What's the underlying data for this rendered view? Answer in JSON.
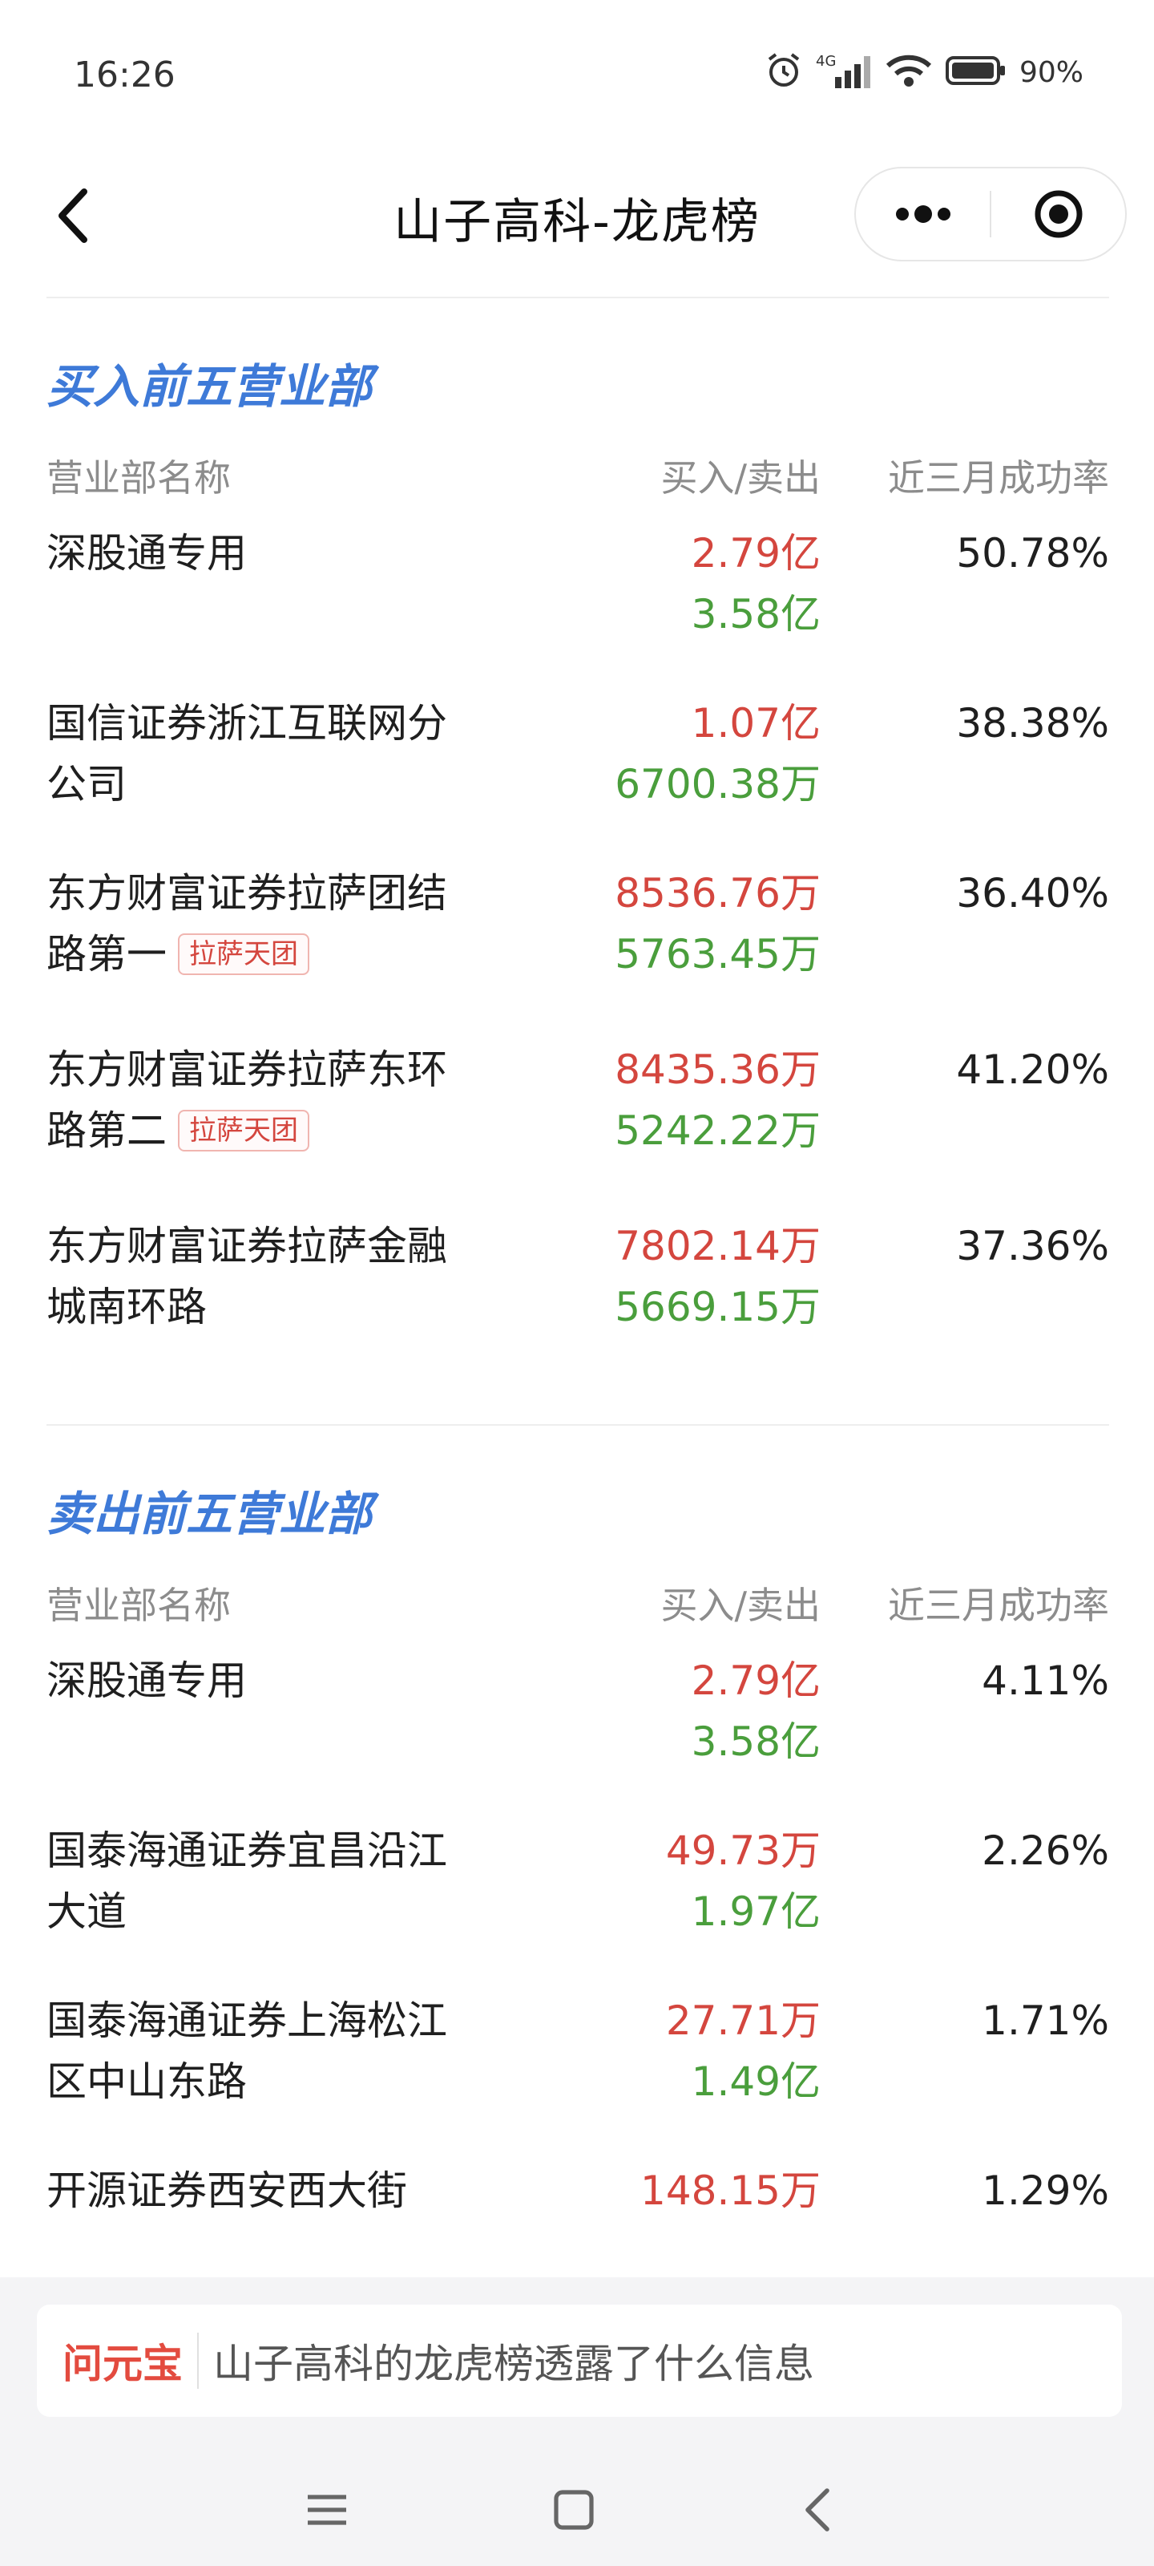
{
  "status_bar": {
    "time": "16:26",
    "network": "4G",
    "battery": "90%"
  },
  "title_bar": {
    "title": "山子高科-龙虎榜"
  },
  "columns": {
    "name": "营业部名称",
    "buy_sell": "买入/卖出",
    "rate": "近三月成功率"
  },
  "buy_section": {
    "title": "买入前五营业部",
    "rows": [
      {
        "name_lines": [
          "深股通专用",
          ""
        ],
        "tag": "",
        "buy": "2.79亿",
        "sell": "3.58亿",
        "rate": "50.78%"
      },
      {
        "name_lines": [
          "国信证券浙江互联网分",
          "公司"
        ],
        "tag": "",
        "buy": "1.07亿",
        "sell": "6700.38万",
        "rate": "38.38%"
      },
      {
        "name_lines": [
          "东方财富证券拉萨团结",
          "路第一"
        ],
        "tag": "拉萨天团",
        "buy": "8536.76万",
        "sell": "5763.45万",
        "rate": "36.40%"
      },
      {
        "name_lines": [
          "东方财富证券拉萨东环",
          "路第二"
        ],
        "tag": "拉萨天团",
        "buy": "8435.36万",
        "sell": "5242.22万",
        "rate": "41.20%"
      },
      {
        "name_lines": [
          "东方财富证券拉萨金融",
          "城南环路"
        ],
        "tag": "",
        "buy": "7802.14万",
        "sell": "5669.15万",
        "rate": "37.36%"
      }
    ]
  },
  "sell_section": {
    "title": "卖出前五营业部",
    "rows": [
      {
        "name_lines": [
          "深股通专用",
          ""
        ],
        "tag": "",
        "buy": "2.79亿",
        "sell": "3.58亿",
        "rate": "4.11%"
      },
      {
        "name_lines": [
          "国泰海通证券宜昌沿江",
          "大道"
        ],
        "tag": "",
        "buy": "49.73万",
        "sell": "1.97亿",
        "rate": "2.26%"
      },
      {
        "name_lines": [
          "国泰海通证券上海松江",
          "区中山东路"
        ],
        "tag": "",
        "buy": "27.71万",
        "sell": "1.49亿",
        "rate": "1.71%"
      },
      {
        "name_lines": [
          "开源证券西安西大街",
          ""
        ],
        "tag": "",
        "buy": "148.15万",
        "sell": "",
        "rate": "1.29%"
      }
    ]
  },
  "ask_bar": {
    "brand": "问元宝",
    "prompt": "山子高科的龙虎榜透露了什么信息"
  },
  "colors": {
    "accent": "#3e7ad8",
    "buy": "#d4463e",
    "sell": "#4a9e3c"
  }
}
